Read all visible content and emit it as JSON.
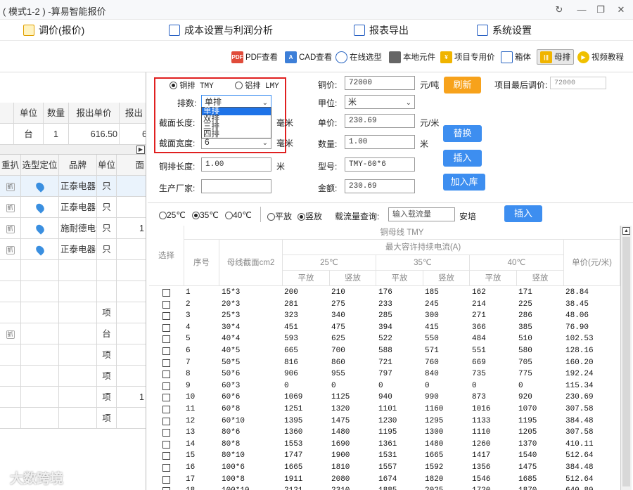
{
  "window": {
    "title": "( 模式1-2 ) -算易智能报价",
    "controls": [
      "↻",
      "—",
      "❐",
      "✕"
    ]
  },
  "menu": {
    "items": [
      "调价(报价)",
      "成本设置与利润分析",
      "报表导出",
      "系统设置"
    ]
  },
  "toolbar": {
    "items": [
      "PDF查看",
      "CAD查看",
      "在线选型",
      "本地元件",
      "项目专用价",
      "箱体",
      "母排",
      "视频教程"
    ],
    "active": "母排"
  },
  "left_top_table": {
    "headers": [
      "单位",
      "数量",
      "报出单价",
      "报出"
    ],
    "row": [
      "台",
      "1",
      "616.50",
      "6"
    ]
  },
  "left_table": {
    "headers": [
      "重扒",
      "选型定位",
      "品牌",
      "单位",
      "面"
    ],
    "rows": [
      {
        "tag": "抓",
        "pin": true,
        "brand": "正泰电器",
        "unit": "只",
        "last": ""
      },
      {
        "tag": "抓",
        "pin": true,
        "brand": "正泰电器",
        "unit": "只",
        "last": ""
      },
      {
        "tag": "抓",
        "pin": true,
        "brand": "施耐德电气",
        "unit": "只",
        "last": "1"
      },
      {
        "tag": "抓",
        "pin": true,
        "brand": "正泰电器",
        "unit": "只",
        "last": ""
      },
      {
        "tag": "",
        "pin": false,
        "brand": "",
        "unit": "",
        "last": ""
      },
      {
        "tag": "",
        "pin": false,
        "brand": "",
        "unit": "",
        "last": ""
      },
      {
        "tag": "",
        "pin": false,
        "brand": "",
        "unit": "项",
        "last": ""
      },
      {
        "tag": "抓",
        "pin": false,
        "brand": "",
        "unit": "台",
        "last": ""
      },
      {
        "tag": "",
        "pin": false,
        "brand": "",
        "unit": "项",
        "last": ""
      },
      {
        "tag": "",
        "pin": false,
        "brand": "",
        "unit": "项",
        "last": ""
      },
      {
        "tag": "",
        "pin": false,
        "brand": "",
        "unit": "项",
        "last": "1"
      },
      {
        "tag": "",
        "pin": false,
        "brand": "",
        "unit": "项",
        "last": ""
      }
    ]
  },
  "form": {
    "radio_copper": "铜排 TMY",
    "radio_aluminum": "铝排 LMY",
    "rows_label": "排数:",
    "rows_value": "单排",
    "rows_options": [
      "单排",
      "双排",
      "三排",
      "四排"
    ],
    "section_length_label": "截面长度:",
    "section_width_label": "截面宽度:",
    "section_width_value": "6",
    "mm1": "毫米",
    "mm2": "毫米",
    "busbar_length_label": "铜排长度:",
    "busbar_length_value": "1.00",
    "meter1": "米",
    "manufacturer_label": "生产厂家:",
    "manufacturer_value": "",
    "copper_price_label": "铜价:",
    "copper_price_value": "72000",
    "copper_price_unit": "元/吨",
    "refresh_btn": "刷新",
    "last_price_label": "项目最后调价:",
    "last_price_value": "72000",
    "unit_label": "甲位:",
    "unit_value": "米",
    "unit_price_label": "单价:",
    "unit_price_value": "230.69",
    "unit_price_unit": "元/米",
    "qty_label": "数量:",
    "qty_value": "1.00",
    "qty_unit": "米",
    "model_label": "型号:",
    "model_value": "TMY-60*6",
    "amount_label": "金额:",
    "amount_value": "230.69",
    "replace_btn": "替换",
    "insert_btn": "插入",
    "add_lib_btn": "加入库"
  },
  "filter": {
    "t25": "25℃",
    "t35": "35℃",
    "t40": "40℃",
    "flat": "平放",
    "vertical": "竖放",
    "query_label": "载流量查询:",
    "query_placeholder": "输入载流量",
    "query_unit": "安培",
    "insert_btn": "插入"
  },
  "table": {
    "title": "铜母线 TMY",
    "ampacity": "最大容许持续电流(A)",
    "h_select": "选择",
    "h_no": "序号",
    "h_section": "母线截面cm2",
    "h_price": "单价(元/米)",
    "h_25": "25℃",
    "h_35": "35℃",
    "h_40": "40℃",
    "h_flat": "平放",
    "h_vert": "竖放",
    "rows": [
      [
        "1",
        "15*3",
        "200",
        "210",
        "176",
        "185",
        "162",
        "171",
        "28.84"
      ],
      [
        "2",
        "20*3",
        "281",
        "275",
        "233",
        "245",
        "214",
        "225",
        "38.45"
      ],
      [
        "3",
        "25*3",
        "323",
        "340",
        "285",
        "300",
        "271",
        "286",
        "48.06"
      ],
      [
        "4",
        "30*4",
        "451",
        "475",
        "394",
        "415",
        "366",
        "385",
        "76.90"
      ],
      [
        "5",
        "40*4",
        "593",
        "625",
        "522",
        "550",
        "484",
        "510",
        "102.53"
      ],
      [
        "6",
        "40*5",
        "665",
        "700",
        "588",
        "571",
        "551",
        "580",
        "128.16"
      ],
      [
        "7",
        "50*5",
        "816",
        "860",
        "721",
        "760",
        "669",
        "705",
        "160.20"
      ],
      [
        "8",
        "50*6",
        "906",
        "955",
        "797",
        "840",
        "735",
        "775",
        "192.24"
      ],
      [
        "9",
        "60*3",
        "0",
        "0",
        "0",
        "0",
        "0",
        "0",
        "115.34"
      ],
      [
        "10",
        "60*6",
        "1069",
        "1125",
        "940",
        "990",
        "873",
        "920",
        "230.69"
      ],
      [
        "11",
        "60*8",
        "1251",
        "1320",
        "1101",
        "1160",
        "1016",
        "1070",
        "307.58"
      ],
      [
        "12",
        "60*10",
        "1395",
        "1475",
        "1230",
        "1295",
        "1133",
        "1195",
        "384.48"
      ],
      [
        "13",
        "80*6",
        "1360",
        "1480",
        "1195",
        "1300",
        "1110",
        "1205",
        "307.58"
      ],
      [
        "14",
        "80*8",
        "1553",
        "1690",
        "1361",
        "1480",
        "1260",
        "1370",
        "410.11"
      ],
      [
        "15",
        "80*10",
        "1747",
        "1900",
        "1531",
        "1665",
        "1417",
        "1540",
        "512.64"
      ],
      [
        "16",
        "100*6",
        "1665",
        "1810",
        "1557",
        "1592",
        "1356",
        "1475",
        "384.48"
      ],
      [
        "17",
        "100*8",
        "1911",
        "2080",
        "1674",
        "1820",
        "1546",
        "1685",
        "512.64"
      ],
      [
        "18",
        "100*10",
        "2121",
        "2310",
        "1885",
        "2025",
        "1720",
        "1870",
        "640.80"
      ]
    ]
  },
  "watermark": "大数跨境"
}
